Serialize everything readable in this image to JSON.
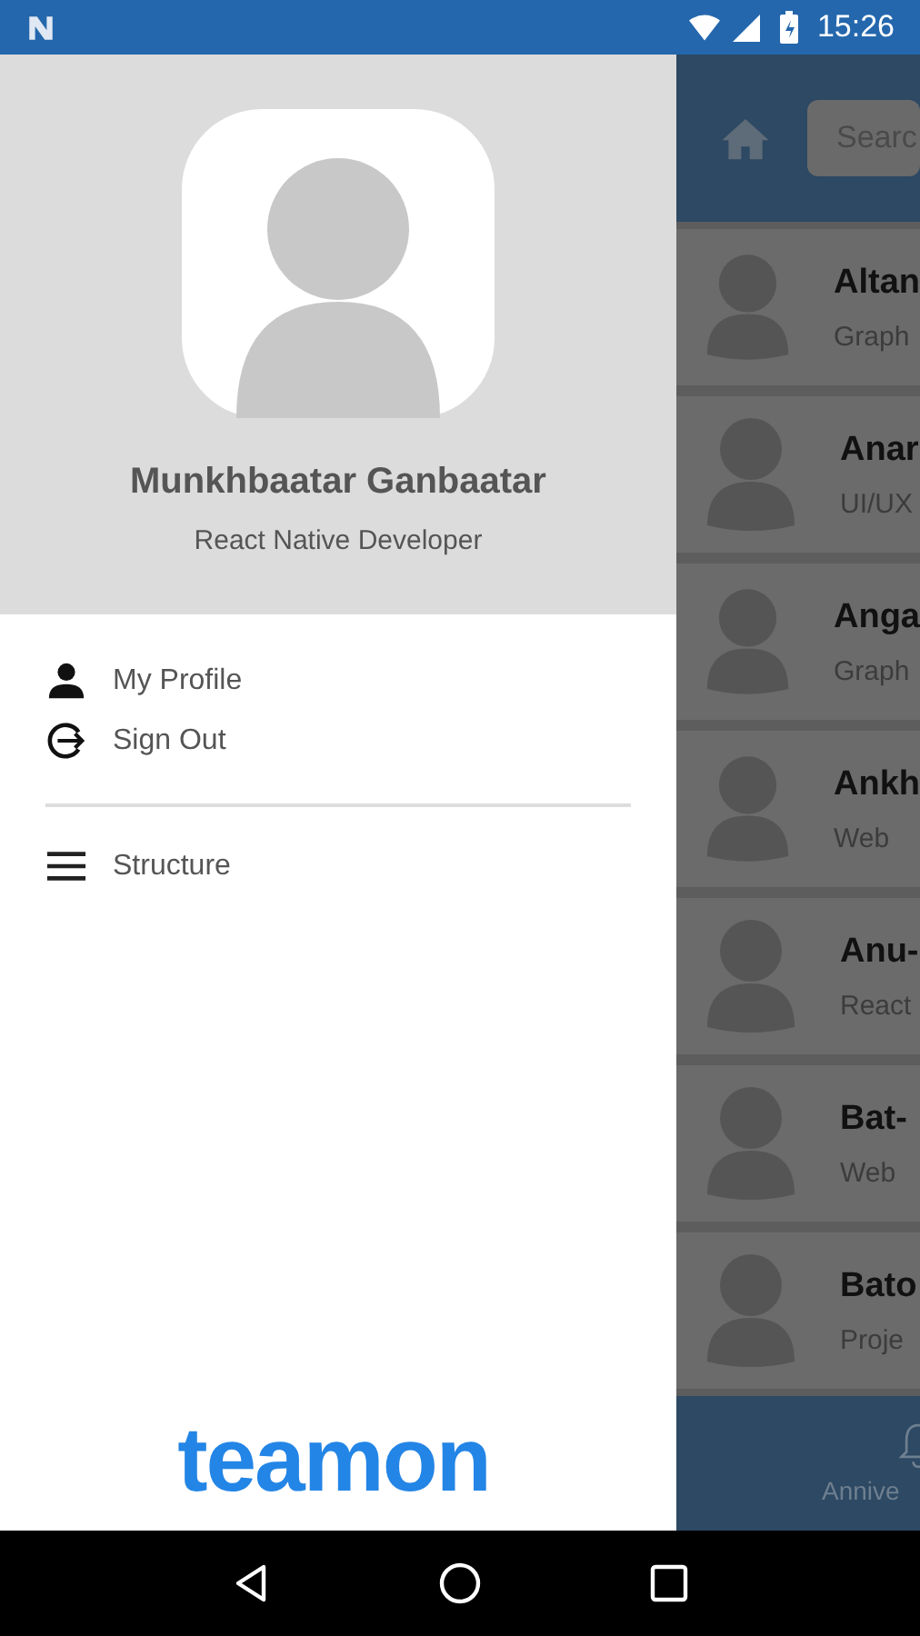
{
  "status_bar": {
    "time": "15:26"
  },
  "drawer": {
    "user_name": "Munkhbaatar Ganbaatar",
    "user_role": "React Native Developer",
    "menu": [
      {
        "label": "My Profile",
        "kind": "profile"
      },
      {
        "label": "Sign Out",
        "kind": "signout"
      },
      {
        "kind": "divider"
      },
      {
        "label": "Structure",
        "kind": "structure"
      }
    ],
    "logo": "teamon"
  },
  "background": {
    "search": {
      "placeholder": "Searc"
    },
    "people": [
      {
        "name": "Altan",
        "role": "Graph"
      },
      {
        "name": "Anar",
        "role": "UI/UX"
      },
      {
        "name": "Anga",
        "role": "Graph"
      },
      {
        "name": "Ankh",
        "role": "Web"
      },
      {
        "name": "Anu-",
        "role": "React"
      },
      {
        "name": "Bat-",
        "role": "Web"
      },
      {
        "name": "Bato",
        "role": "Proje"
      }
    ],
    "tab_label": "Annive"
  }
}
